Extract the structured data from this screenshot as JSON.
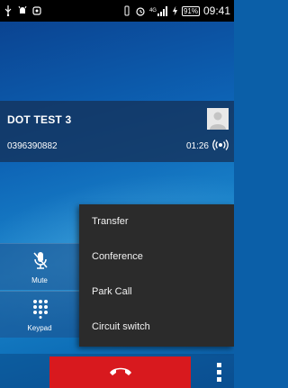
{
  "status_bar": {
    "battery_label": "91%",
    "time": "09:41",
    "network_label": "4G",
    "icons": [
      "usb-icon",
      "android-debug-icon",
      "image-icon",
      "vibrate-icon",
      "alarm-icon",
      "signal-icon",
      "charging-icon",
      "battery-icon"
    ]
  },
  "call": {
    "caller_name": "DOT TEST 3",
    "caller_number": "0396390882",
    "duration": "01:26"
  },
  "controls": {
    "mute_label": "Mute",
    "keypad_label": "Keypad"
  },
  "menu": {
    "items": [
      "Transfer",
      "Conference",
      "Park Call",
      "Circuit switch"
    ]
  },
  "colors": {
    "end_call": "#d8191e",
    "menu_bg": "#2b2b2b"
  }
}
